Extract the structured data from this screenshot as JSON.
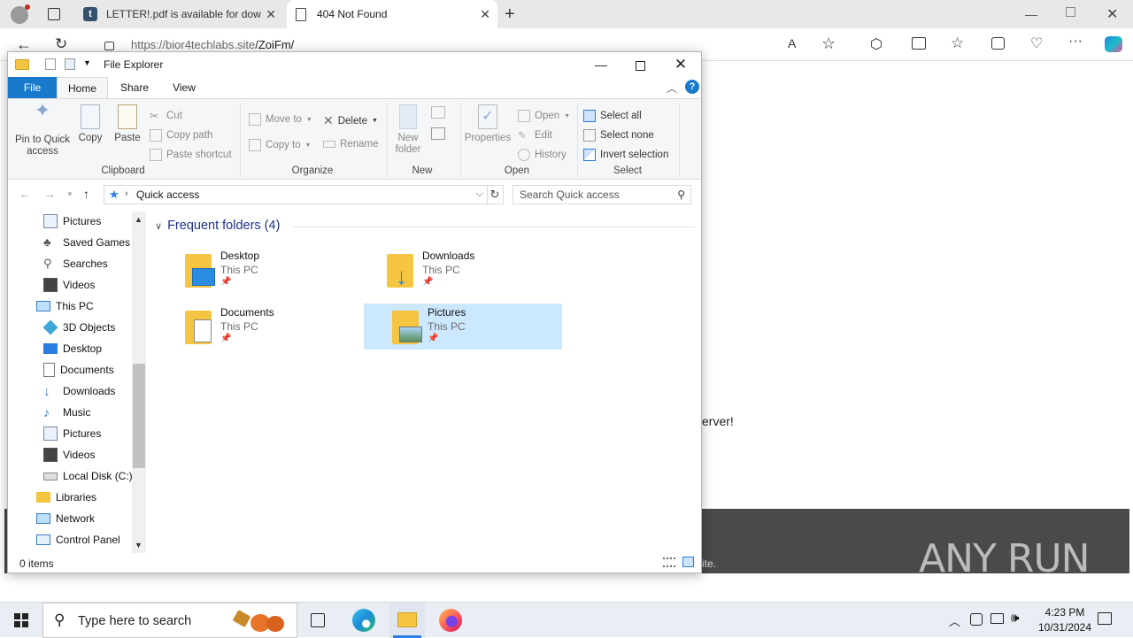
{
  "browser": {
    "tabs": [
      {
        "title": "LETTER!.pdf is available for down",
        "active": false
      },
      {
        "title": "404 Not Found",
        "active": true
      }
    ],
    "url_host": "https://bior4techlabs.site",
    "url_path": "/ZoiFm/",
    "page_text_fragment": "erver!",
    "page_footer_fragment": "ite.",
    "watermark": "ANY RUN"
  },
  "explorer": {
    "title": "File Explorer",
    "ribbon_tabs": [
      "File",
      "Home",
      "Share",
      "View"
    ],
    "ribbon": {
      "clipboard": {
        "label": "Clipboard",
        "pin": "Pin to Quick access",
        "copy": "Copy",
        "paste": "Paste",
        "cut": "Cut",
        "copy_path": "Copy path",
        "paste_shortcut": "Paste shortcut"
      },
      "organize": {
        "label": "Organize",
        "move_to": "Move to",
        "copy_to": "Copy to",
        "delete": "Delete",
        "rename": "Rename"
      },
      "new": {
        "label": "New",
        "new_folder": "New folder"
      },
      "open": {
        "label": "Open",
        "properties": "Properties",
        "open": "Open",
        "edit": "Edit",
        "history": "History"
      },
      "select": {
        "label": "Select",
        "select_all": "Select all",
        "select_none": "Select none",
        "invert": "Invert selection"
      }
    },
    "address": "Quick access",
    "search_placeholder": "Search Quick access",
    "nav_items": [
      {
        "label": "Pictures",
        "icon": "pictures-icon"
      },
      {
        "label": "Saved Games",
        "icon": "saved-games-icon"
      },
      {
        "label": "Searches",
        "icon": "searches-icon"
      },
      {
        "label": "Videos",
        "icon": "videos-icon"
      },
      {
        "label": "This PC",
        "icon": "this-pc-icon"
      },
      {
        "label": "3D Objects",
        "icon": "3d-objects-icon"
      },
      {
        "label": "Desktop",
        "icon": "desktop-icon"
      },
      {
        "label": "Documents",
        "icon": "documents-icon"
      },
      {
        "label": "Downloads",
        "icon": "downloads-icon"
      },
      {
        "label": "Music",
        "icon": "music-icon"
      },
      {
        "label": "Pictures",
        "icon": "pictures-icon"
      },
      {
        "label": "Videos",
        "icon": "videos-icon"
      },
      {
        "label": "Local Disk (C:)",
        "icon": "local-disk-icon"
      },
      {
        "label": "Libraries",
        "icon": "libraries-icon"
      },
      {
        "label": "Network",
        "icon": "network-icon"
      },
      {
        "label": "Control Panel",
        "icon": "control-panel-icon"
      }
    ],
    "section_header": "Frequent folders (4)",
    "folders": [
      {
        "name": "Desktop",
        "location": "This PC",
        "selected": false
      },
      {
        "name": "Downloads",
        "location": "This PC",
        "selected": false
      },
      {
        "name": "Documents",
        "location": "This PC",
        "selected": false
      },
      {
        "name": "Pictures",
        "location": "This PC",
        "selected": true
      }
    ],
    "status": "0 items"
  },
  "taskbar": {
    "search_placeholder": "Type here to search",
    "time": "4:23 PM",
    "date": "10/31/2024"
  },
  "colors": {
    "file_tab": "#1979ca",
    "selection": "#cce8ff",
    "section_header": "#1e3287"
  }
}
